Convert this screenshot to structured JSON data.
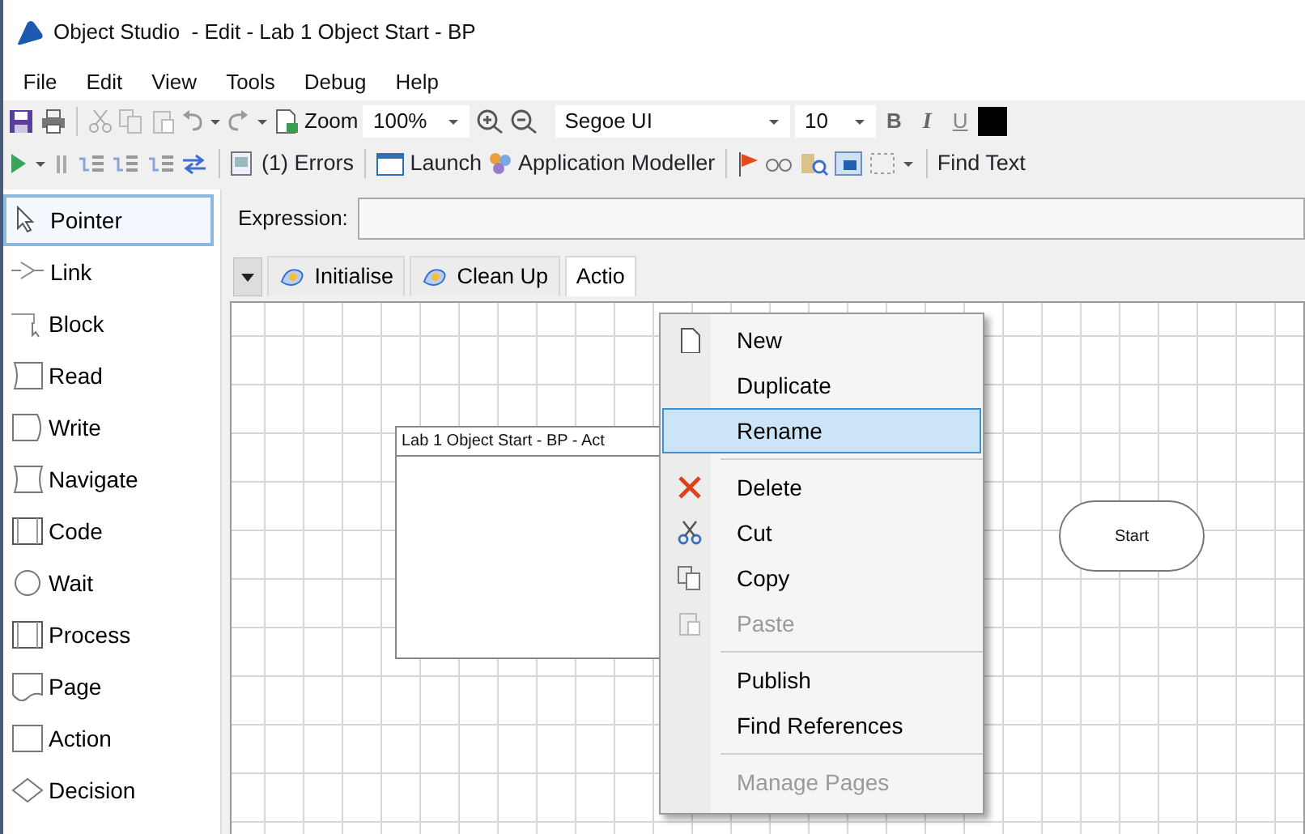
{
  "window": {
    "title": "Object Studio  - Edit - Lab 1 Object Start - BP"
  },
  "menu": [
    "File",
    "Edit",
    "View",
    "Tools",
    "Debug",
    "Help"
  ],
  "toolbar": {
    "zoom_label": "Zoom",
    "zoom_value": "100%",
    "font": "Segoe UI",
    "font_size": "10",
    "bold": "B",
    "italic": "I",
    "underline": "U"
  },
  "debug_toolbar": {
    "errors": "(1) Errors",
    "launch": "Launch",
    "application_modeller": "Application Modeller",
    "find_text": "Find Text"
  },
  "palette": [
    {
      "label": "Pointer",
      "selected": true
    },
    {
      "label": "Link",
      "selected": false
    },
    {
      "label": "Block",
      "selected": false
    },
    {
      "label": "Read",
      "selected": false
    },
    {
      "label": "Write",
      "selected": false
    },
    {
      "label": "Navigate",
      "selected": false
    },
    {
      "label": "Code",
      "selected": false
    },
    {
      "label": "Wait",
      "selected": false
    },
    {
      "label": "Process",
      "selected": false
    },
    {
      "label": "Page",
      "selected": false
    },
    {
      "label": "Action",
      "selected": false
    },
    {
      "label": "Decision",
      "selected": false
    }
  ],
  "expression": {
    "label": "Expression:"
  },
  "tabs": [
    {
      "label": "Initialise",
      "selected": false
    },
    {
      "label": "Clean Up",
      "selected": false
    },
    {
      "label": "Actio",
      "selected": true
    }
  ],
  "canvas": {
    "page_box_title": "Lab 1 Object Start - BP - Act",
    "start_label": "Start"
  },
  "context_menu": [
    {
      "kind": "item",
      "label": "New",
      "disabled": false,
      "selected": false
    },
    {
      "kind": "item",
      "label": "Duplicate",
      "disabled": false,
      "selected": false
    },
    {
      "kind": "item",
      "label": "Rename",
      "disabled": false,
      "selected": true
    },
    {
      "kind": "separator"
    },
    {
      "kind": "item",
      "label": "Delete",
      "disabled": false,
      "selected": false
    },
    {
      "kind": "item",
      "label": "Cut",
      "disabled": false,
      "selected": false
    },
    {
      "kind": "item",
      "label": "Copy",
      "disabled": false,
      "selected": false
    },
    {
      "kind": "item",
      "label": "Paste",
      "disabled": true,
      "selected": false
    },
    {
      "kind": "separator"
    },
    {
      "kind": "item",
      "label": "Publish",
      "disabled": false,
      "selected": false
    },
    {
      "kind": "item",
      "label": "Find References",
      "disabled": false,
      "selected": false
    },
    {
      "kind": "separator"
    },
    {
      "kind": "item",
      "label": "Manage Pages",
      "disabled": true,
      "selected": false
    }
  ]
}
